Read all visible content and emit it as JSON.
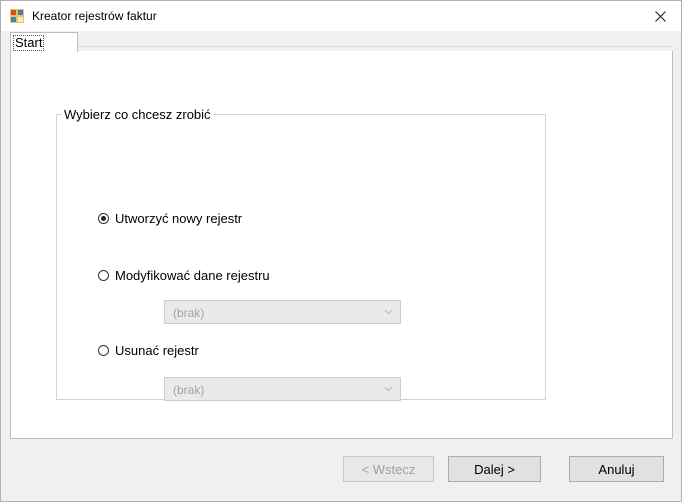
{
  "window": {
    "title": "Kreator rejestrów faktur",
    "close_glyph": "✕"
  },
  "tabs": [
    {
      "label": "Start",
      "selected": true
    }
  ],
  "group": {
    "legend": "Wybierz co chcesz zrobić",
    "options": [
      {
        "label": "Utworzyć nowy rejestr",
        "checked": true
      },
      {
        "label": "Modyfikować dane rejestru",
        "checked": false
      },
      {
        "label": "Usunać rejestr",
        "checked": false
      }
    ],
    "modify_combo": {
      "value": "(brak)",
      "enabled": false
    },
    "delete_combo": {
      "value": "(brak)",
      "enabled": false
    }
  },
  "footer": {
    "back_label": "< Wstecz",
    "next_label": "Dalej >",
    "cancel_label": "Anuluj"
  },
  "icons": {
    "app": "register-app-icon",
    "close": "close-icon",
    "combo_arrow": "chevron-down-icon"
  }
}
